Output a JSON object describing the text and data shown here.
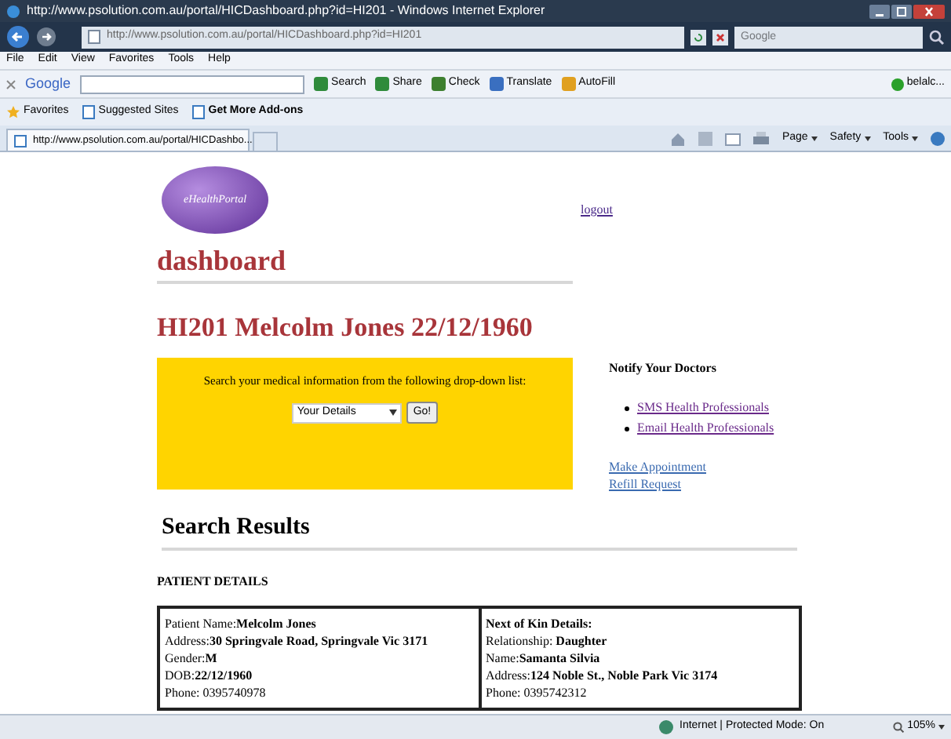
{
  "window": {
    "title": "http://www.psolution.com.au/portal/HICDashboard.php?id=HI201 - Windows Internet Explorer"
  },
  "address_bar": {
    "url": "http://www.psolution.com.au/portal/HICDashboard.php?id=HI201"
  },
  "search_box": {
    "placeholder": "Google"
  },
  "menu": [
    "File",
    "Edit",
    "View",
    "Favorites",
    "Tools",
    "Help"
  ],
  "google_toolbar": {
    "brand": "Google",
    "items": [
      "Search",
      "Share",
      "Check",
      "Translate",
      "AutoFill"
    ],
    "account": "belalc..."
  },
  "favorites_bar": [
    "Favorites",
    "Suggested Sites",
    "Get More Add-ons"
  ],
  "tab": {
    "title": "http://www.psolution.com.au/portal/HICDashbo..."
  },
  "command_bar": [
    "Page",
    "Safety",
    "Tools"
  ],
  "page": {
    "logo": "eHealthPortal",
    "logout": "logout",
    "title": "dashboard",
    "patient_heading": "HI201 Melcolm Jones 22/12/1960",
    "search_panel": {
      "prompt": "Search your medical information from the following drop-down list:",
      "dropdown": "Your Details",
      "button": "Go!"
    },
    "notify": {
      "heading": "Notify Your Doctors",
      "links": [
        "SMS Health Professionals",
        "Email Health Professionals"
      ]
    },
    "links": [
      "Make Appointment",
      "Refill Request"
    ],
    "results_heading": "Search Results",
    "section": "PATIENT DETAILS",
    "details": [
      [
        "Patient Name:**Melcolm Jones**",
        "Address:**30 Springvale Road, Springvale Vic 3171**",
        "Gender:**M**",
        "DOB:**22/12/1960**",
        "Phone: 0395740978"
      ],
      [
        "**Next of Kin Details:**",
        "Relationship: **Daughter**",
        "Name:**Samanta Silvia**",
        "Address:**124 Noble St., Noble Park Vic 3174**",
        "Phone: 0395742312"
      ]
    ]
  },
  "status_bar": {
    "zone": "Internet | Protected Mode: On",
    "zoom": "105%"
  }
}
